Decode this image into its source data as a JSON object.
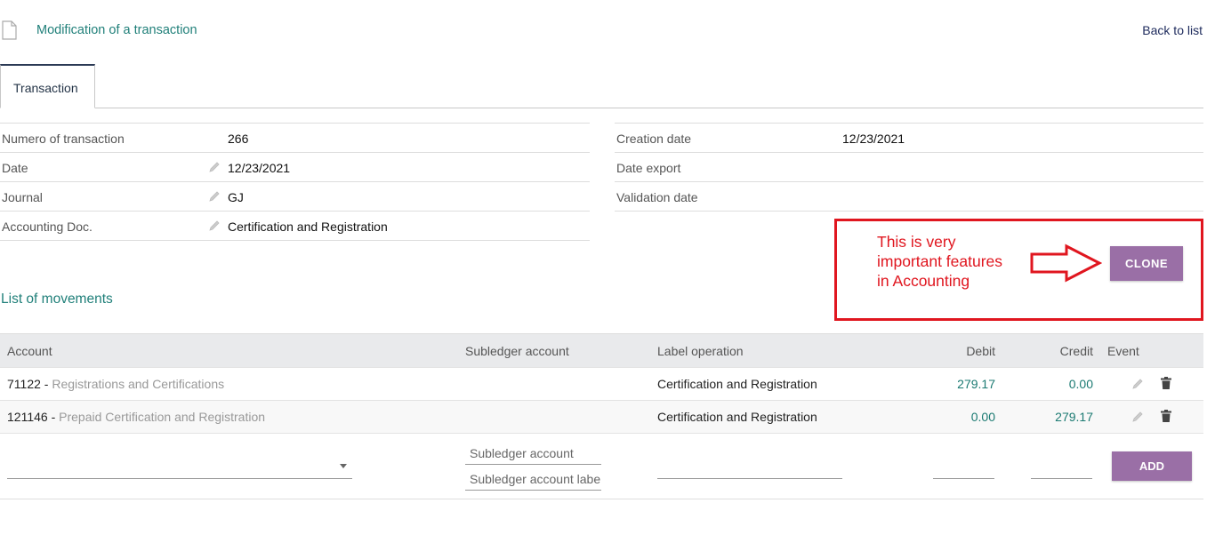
{
  "header": {
    "title": "Modification of a transaction",
    "back_label": "Back to list"
  },
  "tabs": [
    {
      "label": "Transaction"
    }
  ],
  "fields_left": [
    {
      "label": "Numero of transaction",
      "value": "266",
      "editable": false
    },
    {
      "label": "Date",
      "value": "12/23/2021",
      "editable": true
    },
    {
      "label": "Journal",
      "value": "GJ",
      "editable": true
    },
    {
      "label": "Accounting Doc.",
      "value": "Certification and Registration",
      "editable": true
    }
  ],
  "fields_right": [
    {
      "label": "Creation date",
      "value": "12/23/2021"
    },
    {
      "label": "Date export",
      "value": ""
    },
    {
      "label": "Validation date",
      "value": ""
    }
  ],
  "annotation": {
    "line1": "This is very",
    "line2": "important features",
    "line3": "in Accounting",
    "color": "#e0161f"
  },
  "clone_label": "CLONE",
  "movements": {
    "title": "List of movements",
    "columns": {
      "account": "Account",
      "subledger": "Subledger account",
      "label": "Label operation",
      "debit": "Debit",
      "credit": "Credit",
      "event": "Event"
    },
    "rows": [
      {
        "account_num": "71122",
        "sep": " - ",
        "account_name": "Registrations and Certifications",
        "label": "Certification and Registration",
        "debit": "279.17",
        "credit": "0.00"
      },
      {
        "account_num": "121146",
        "sep": " - ",
        "account_name": "Prepaid Certification and Registration",
        "label": "Certification and Registration",
        "debit": "0.00",
        "credit": "279.17"
      }
    ],
    "add_row": {
      "subledger_placeholder": "Subledger account",
      "subledger_label_placeholder": "Subledger account label",
      "add_label": "ADD"
    }
  },
  "colors": {
    "accent_teal": "#21807a",
    "button_purple": "#9a6fa6",
    "header_gray": "#e9eaec"
  }
}
